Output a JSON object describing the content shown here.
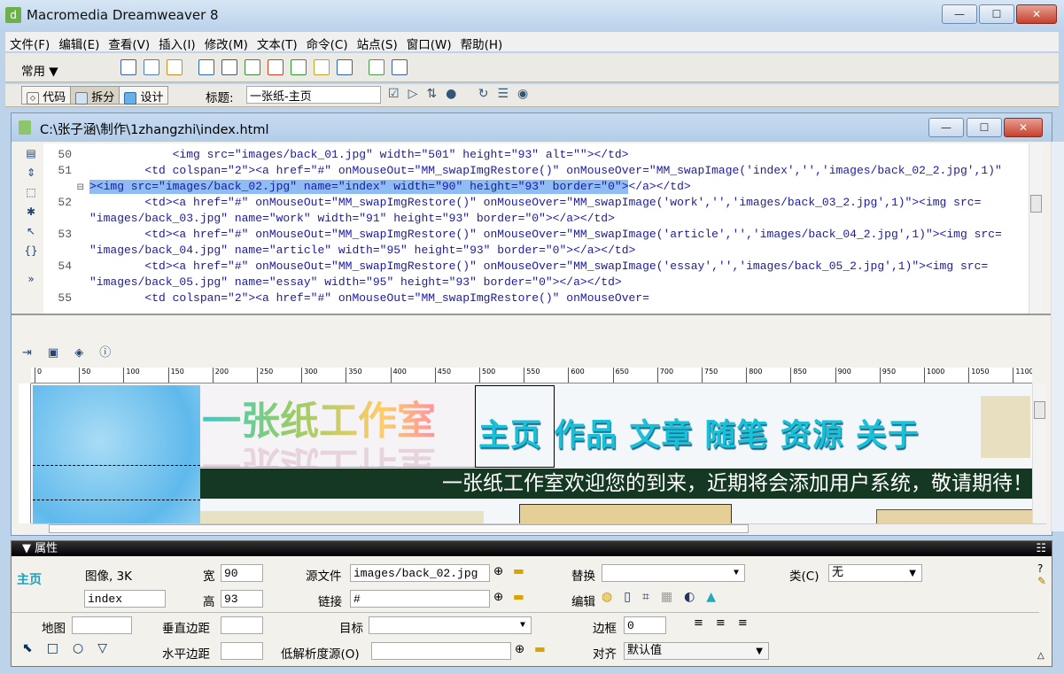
{
  "window": {
    "title": "Macromedia Dreamweaver 8"
  },
  "menu": [
    "文件(F)",
    "编辑(E)",
    "查看(V)",
    "插入(I)",
    "修改(M)",
    "文本(T)",
    "命令(C)",
    "站点(S)",
    "窗口(W)",
    "帮助(H)"
  ],
  "insert_bar": {
    "category": "常用",
    "icons": [
      "hyperlink-icon",
      "email-link-icon",
      "named-anchor-icon",
      "table-icon",
      "div-icon",
      "image-icon",
      "media-icon",
      "date-icon",
      "comment-icon",
      "server-side-include-icon",
      "template-icon",
      "tag-chooser-icon"
    ]
  },
  "doc_toolbar": {
    "code": "代码",
    "split": "拆分",
    "design": "设计",
    "title_label": "标题:",
    "title_value": "一张纸-主页",
    "active_view": "split"
  },
  "document": {
    "path": "C:\\张子涵\\制作\\1zhangzhi\\index.html"
  },
  "code_lines": [
    {
      "num": "50",
      "text": "            <img src=\"images/back_01.jpg\" width=\"501\" height=\"93\" alt=\"\"></td>"
    },
    {
      "num": "51",
      "text": "        <td colspan=\"2\"><a href=\"#\" onMouseOut=\"MM_swapImgRestore()\" onMouseOver=\"MM_swapImage('index','','images/back_02_2.jpg',1)\""
    },
    {
      "num": "",
      "text": "><img src=\"images/back_02.jpg\" name=\"index\" width=\"90\" height=\"93\" border=\"0\"></a></td>",
      "highlight": "><img src=\"images/back_02.jpg\" name=\"index\" width=\"90\" height=\"93\" border=\"0\">"
    },
    {
      "num": "52",
      "text": "        <td><a href=\"#\" onMouseOut=\"MM_swapImgRestore()\" onMouseOver=\"MM_swapImage('work','','images/back_03_2.jpg',1)\"><img src="
    },
    {
      "num": "",
      "text": "\"images/back_03.jpg\" name=\"work\" width=\"91\" height=\"93\" border=\"0\"></a></td>"
    },
    {
      "num": "53",
      "text": "        <td><a href=\"#\" onMouseOut=\"MM_swapImgRestore()\" onMouseOver=\"MM_swapImage('article','','images/back_04_2.jpg',1)\"><img src="
    },
    {
      "num": "",
      "text": "\"images/back_04.jpg\" name=\"article\" width=\"95\" height=\"93\" border=\"0\"></a></td>"
    },
    {
      "num": "54",
      "text": "        <td><a href=\"#\" onMouseOut=\"MM_swapImgRestore()\" onMouseOver=\"MM_swapImage('essay','','images/back_05_2.jpg',1)\"><img src="
    },
    {
      "num": "",
      "text": "\"images/back_05.jpg\" name=\"essay\" width=\"95\" height=\"93\" border=\"0\"></a></td>"
    },
    {
      "num": "55",
      "text": "        <td colspan=\"2\"><a href=\"#\" onMouseOut=\"MM_swapImgRestore()\" onMouseOver="
    }
  ],
  "ruler": [
    "0",
    "50",
    "100",
    "150",
    "200",
    "250",
    "300",
    "350",
    "400",
    "450",
    "500",
    "550",
    "600",
    "650",
    "700",
    "750",
    "800",
    "850",
    "900",
    "950",
    "1000",
    "1050",
    "1100"
  ],
  "design": {
    "logo": "一张纸工作室",
    "nav": "主页 作品 文章 随笔 资源 关于",
    "welcome": "一张纸工作室欢迎您的到来，近期将会添加用户系统，敬请期待！"
  },
  "props": {
    "title": "属性",
    "thumb": "主页",
    "type": "图像, 3K",
    "name": "index",
    "w_label": "宽",
    "w": "90",
    "h_label": "高",
    "h": "93",
    "src_label": "源文件",
    "src": "images/back_02.jpg",
    "link_label": "链接",
    "link": "#",
    "alt_label": "替换",
    "alt": "",
    "class_label": "类(C)",
    "class": "无",
    "edit_label": "编辑",
    "map_label": "地图",
    "map": "",
    "vspace_label": "垂直边距",
    "vspace": "",
    "hspace_label": "水平边距",
    "hspace": "",
    "target_label": "目标",
    "target": "",
    "lowsrc_label": "低解析度源(O)",
    "lowsrc": "",
    "border_label": "边框",
    "border": "0",
    "align_label": "对齐",
    "align": "默认值"
  }
}
